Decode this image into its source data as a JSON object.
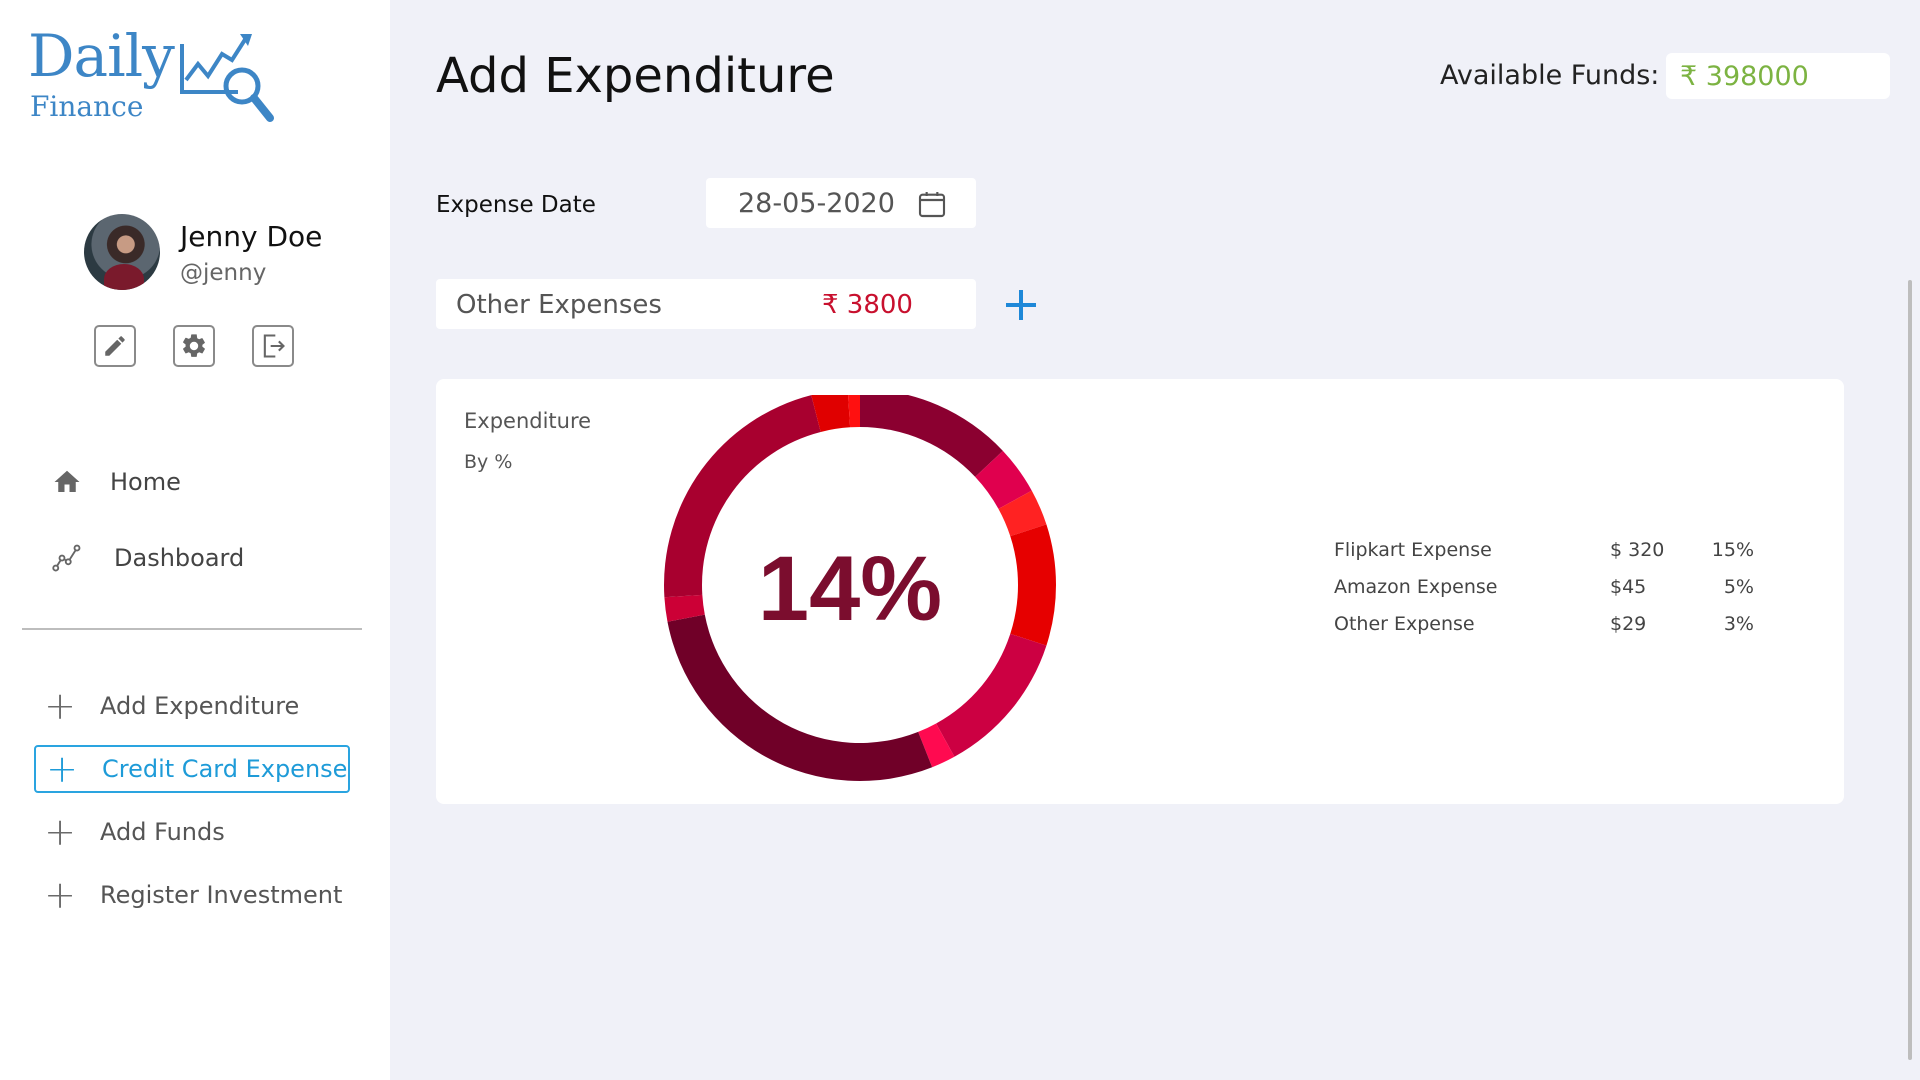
{
  "app": {
    "logo_line1": "Daily",
    "logo_line2": "Finance"
  },
  "profile": {
    "name": "Jenny Doe",
    "handle": "@jenny"
  },
  "nav": [
    {
      "label": "Home",
      "icon": "home-icon"
    },
    {
      "label": "Dashboard",
      "icon": "analytics-icon"
    }
  ],
  "actions": [
    {
      "label": "Add Expenditure",
      "active": false
    },
    {
      "label": "Credit Card Expense",
      "active": true
    },
    {
      "label": "Add Funds",
      "active": false
    },
    {
      "label": "Register Investment",
      "active": false
    }
  ],
  "header": {
    "title": "Add Expenditure",
    "funds_label": "Available Funds:",
    "funds_value": "₹ 398000"
  },
  "form": {
    "date_label": "Expense Date",
    "date_value": "28-05-2020",
    "expense_name": "Other Expenses",
    "expense_amount": "₹ 3800"
  },
  "chart": {
    "title": "Expenditure",
    "subtitle": "By %",
    "center_value": "14%",
    "legend": [
      {
        "name": "Flipkart Expense",
        "value": "$ 320",
        "pct": "15%"
      },
      {
        "name": "Amazon Expense",
        "value": "$45",
        "pct": "5%"
      },
      {
        "name": "Other Expense",
        "value": "$29",
        "pct": "3%"
      }
    ]
  },
  "chart_data": {
    "type": "pie",
    "title": "Expenditure",
    "subtitle": "By %",
    "center_label": "14%",
    "slices": [
      {
        "value": 13,
        "color": "#8b0030"
      },
      {
        "value": 4,
        "color": "#e0004e"
      },
      {
        "value": 3,
        "color": "#ff2222"
      },
      {
        "value": 10,
        "color": "#e60000"
      },
      {
        "value": 12,
        "color": "#cc0042"
      },
      {
        "value": 2,
        "color": "#ff0a50"
      },
      {
        "value": 28,
        "color": "#700028"
      },
      {
        "value": 2,
        "color": "#cc0036"
      },
      {
        "value": 22,
        "color": "#a8002f"
      },
      {
        "value": 3,
        "color": "#e00000"
      },
      {
        "value": 1,
        "color": "#ff1010"
      }
    ],
    "legend": [
      {
        "name": "Flipkart Expense",
        "value": 320,
        "pct": 15
      },
      {
        "name": "Amazon Expense",
        "value": 45,
        "pct": 5
      },
      {
        "name": "Other Expense",
        "value": 29,
        "pct": 3
      }
    ]
  }
}
